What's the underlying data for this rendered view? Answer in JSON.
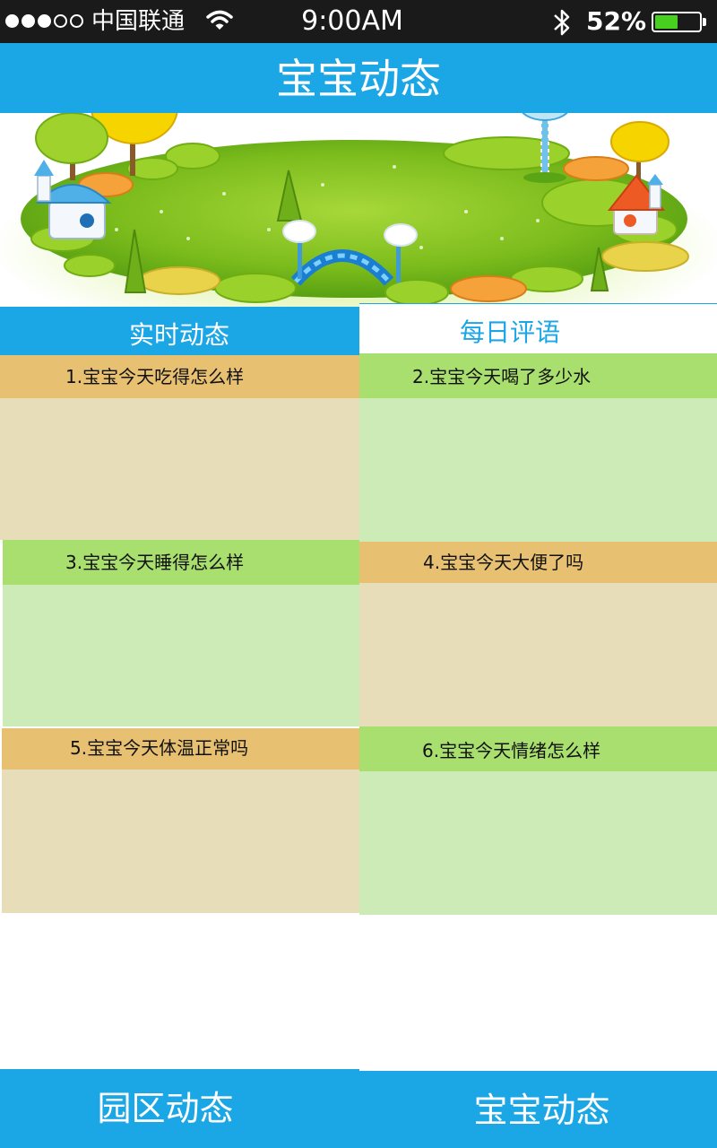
{
  "status_bar": {
    "carrier": "中国联通",
    "time": "9:00AM",
    "battery_percent": "52%",
    "battery_level": 0.52,
    "signal_bars_filled": 3,
    "signal_bars_total": 5
  },
  "nav": {
    "title": "宝宝动态"
  },
  "banner": {
    "icon": "park-landscape-illustration"
  },
  "tabs": [
    {
      "label": "实时动态",
      "active": true
    },
    {
      "label": "每日评语",
      "active": false
    }
  ],
  "cards": [
    {
      "title": "1.宝宝今天吃得怎么样",
      "color": "#e7c071"
    },
    {
      "title": "2.宝宝今天喝了多少水",
      "color": "#a8df6e"
    },
    {
      "title": "3.宝宝今天睡得怎么样",
      "color": "#a8df6e"
    },
    {
      "title": "4.宝宝今天大便了吗",
      "color": "#e7c071"
    },
    {
      "title": "5.宝宝今天体温正常吗",
      "color": "#e7c071"
    },
    {
      "title": "6.宝宝今天情绪怎么样",
      "color": "#a8df6e"
    }
  ],
  "bottom_nav": [
    {
      "label": "园区动态"
    },
    {
      "label": "宝宝动态"
    }
  ],
  "colors": {
    "primary": "#1ba6e6",
    "status_bar": "#1a1a1a",
    "orange_head": "#e7c071",
    "orange_body": "#e7deb9",
    "green_head": "#a8df6e",
    "green_body": "#ccebb7"
  }
}
